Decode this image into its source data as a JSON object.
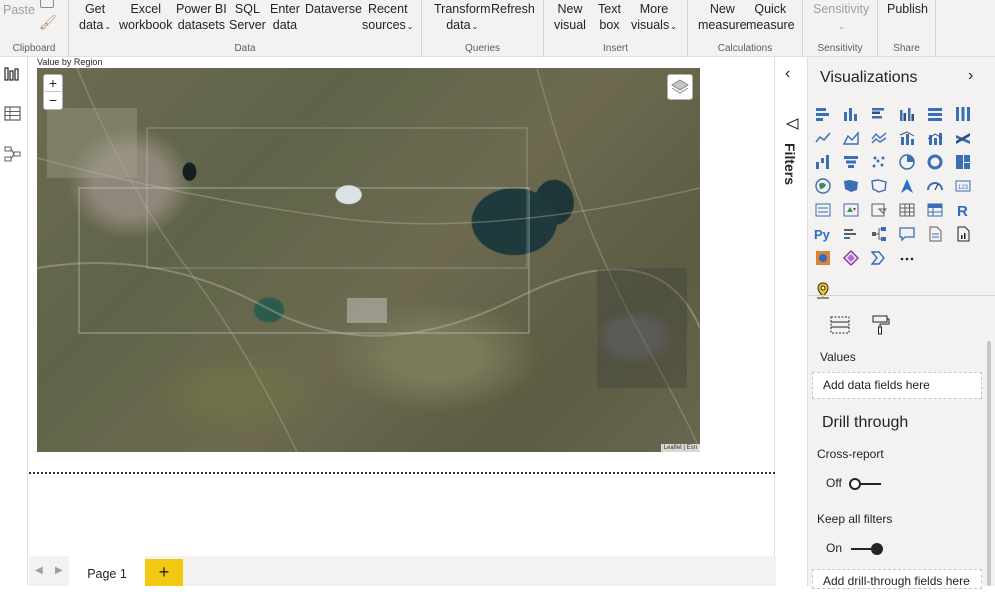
{
  "ribbon": {
    "clipboard": {
      "paste": "Paste",
      "group": "Clipboard"
    },
    "data": {
      "group": "Data",
      "get_data": [
        "Get",
        "data"
      ],
      "excel": [
        "Excel",
        "workbook"
      ],
      "pbi_datasets": [
        "Power BI",
        "datasets"
      ],
      "sql": [
        "SQL",
        "Server"
      ],
      "enter": [
        "Enter",
        "data"
      ],
      "dataverse": "Dataverse",
      "recent": [
        "Recent",
        "sources"
      ]
    },
    "queries": {
      "group": "Queries",
      "transform": [
        "Transform",
        "data"
      ],
      "refresh": "Refresh"
    },
    "insert": {
      "group": "Insert",
      "new_visual": [
        "New",
        "visual"
      ],
      "text_box": [
        "Text",
        "box"
      ],
      "more_visuals": [
        "More",
        "visuals"
      ]
    },
    "calculations": {
      "group": "Calculations",
      "new_measure": [
        "New",
        "measure"
      ],
      "quick_measure": [
        "Quick",
        "measure"
      ]
    },
    "sensitivity": {
      "group": "Sensitivity",
      "label": "Sensitivity"
    },
    "share": {
      "group": "Share",
      "publish": "Publish"
    }
  },
  "canvas": {
    "visual_title": "Value by Region",
    "map": {
      "zoom_in": "+",
      "zoom_out": "−",
      "attribution": "Leaflet | Esri"
    }
  },
  "pages": {
    "tabs": [
      "Page 1"
    ],
    "add": "+"
  },
  "filters": {
    "label": "Filters"
  },
  "viz": {
    "title": "Visualizations",
    "values_label": "Values",
    "values_placeholder": "Add data fields here",
    "drill_through": "Drill through",
    "cross_report": "Cross-report",
    "cross_report_state": "Off",
    "keep_filters": "Keep all filters",
    "keep_filters_state": "On",
    "drill_placeholder": "Add drill-through fields here"
  },
  "colors": {
    "accent": "#f2c811",
    "ribbon_bg": "#f3f2f1",
    "icon_blue": "#3a6fb5"
  }
}
